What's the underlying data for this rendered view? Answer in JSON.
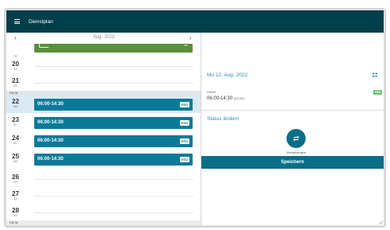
{
  "appbar": {
    "title": "Dienstplan"
  },
  "nav": {
    "month": "Aug. 2022",
    "prev": "‹",
    "next": "›"
  },
  "calendar": {
    "top_day": {
      "name": "FR"
    },
    "days": [
      {
        "num": "20",
        "name": "SA"
      },
      {
        "num": "21",
        "name": "SO"
      },
      {
        "num": "22",
        "name": "MO",
        "shift": "06:00-14:30",
        "tag": "FRÜ"
      },
      {
        "num": "23",
        "name": "DI",
        "shift": "06:00-14:30",
        "tag": "FRÜ"
      },
      {
        "num": "24",
        "name": "MI",
        "shift": "06:00-14:30",
        "tag": "FRÜ"
      },
      {
        "num": "25",
        "name": "DO",
        "shift": "06:00-14:30",
        "tag": "FRÜ"
      },
      {
        "num": "26",
        "name": "FR"
      },
      {
        "num": "27",
        "name": "SA"
      },
      {
        "num": "28",
        "name": "SO"
      }
    ],
    "week_labels": [
      "KW 34",
      "KW 35"
    ]
  },
  "detail": {
    "date": "Mo 22. Aug. 2022",
    "label": "Dienst",
    "time": "06:00-14:30",
    "duration": "(23:0K)",
    "badge": "FRÜ",
    "status_title": "Status ändern",
    "swap_label": "Dienstübergabe",
    "save_label": "Speichern"
  },
  "colors": {
    "appbar": "#003e4a",
    "shift": "#0b7a99",
    "accent": "#2f8ab0",
    "green": "#5a8f3c"
  },
  "icons": [
    "menu-icon",
    "chevron-left-icon",
    "chevron-right-icon",
    "people-icon",
    "swap-icon",
    "resize-grip-icon"
  ]
}
